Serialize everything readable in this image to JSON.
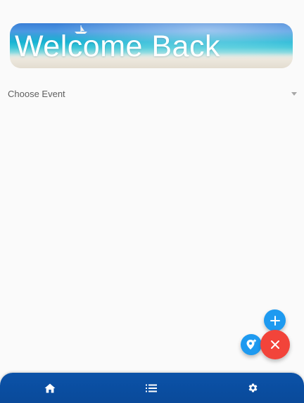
{
  "banner": {
    "title": "Welcome Back"
  },
  "event_selector": {
    "placeholder": "Choose Event"
  },
  "fabs": {
    "add_icon": "plus-icon",
    "location_icon": "add-location-icon",
    "close_icon": "close-icon"
  },
  "bottom_nav": {
    "items": [
      {
        "icon": "home-icon"
      },
      {
        "icon": "list-icon"
      },
      {
        "icon": "gear-icon"
      }
    ]
  },
  "colors": {
    "fab_blue": "#1e9af0",
    "fab_red": "#f2443a",
    "nav_bar": "#0b52a8",
    "background": "#fafafa"
  }
}
